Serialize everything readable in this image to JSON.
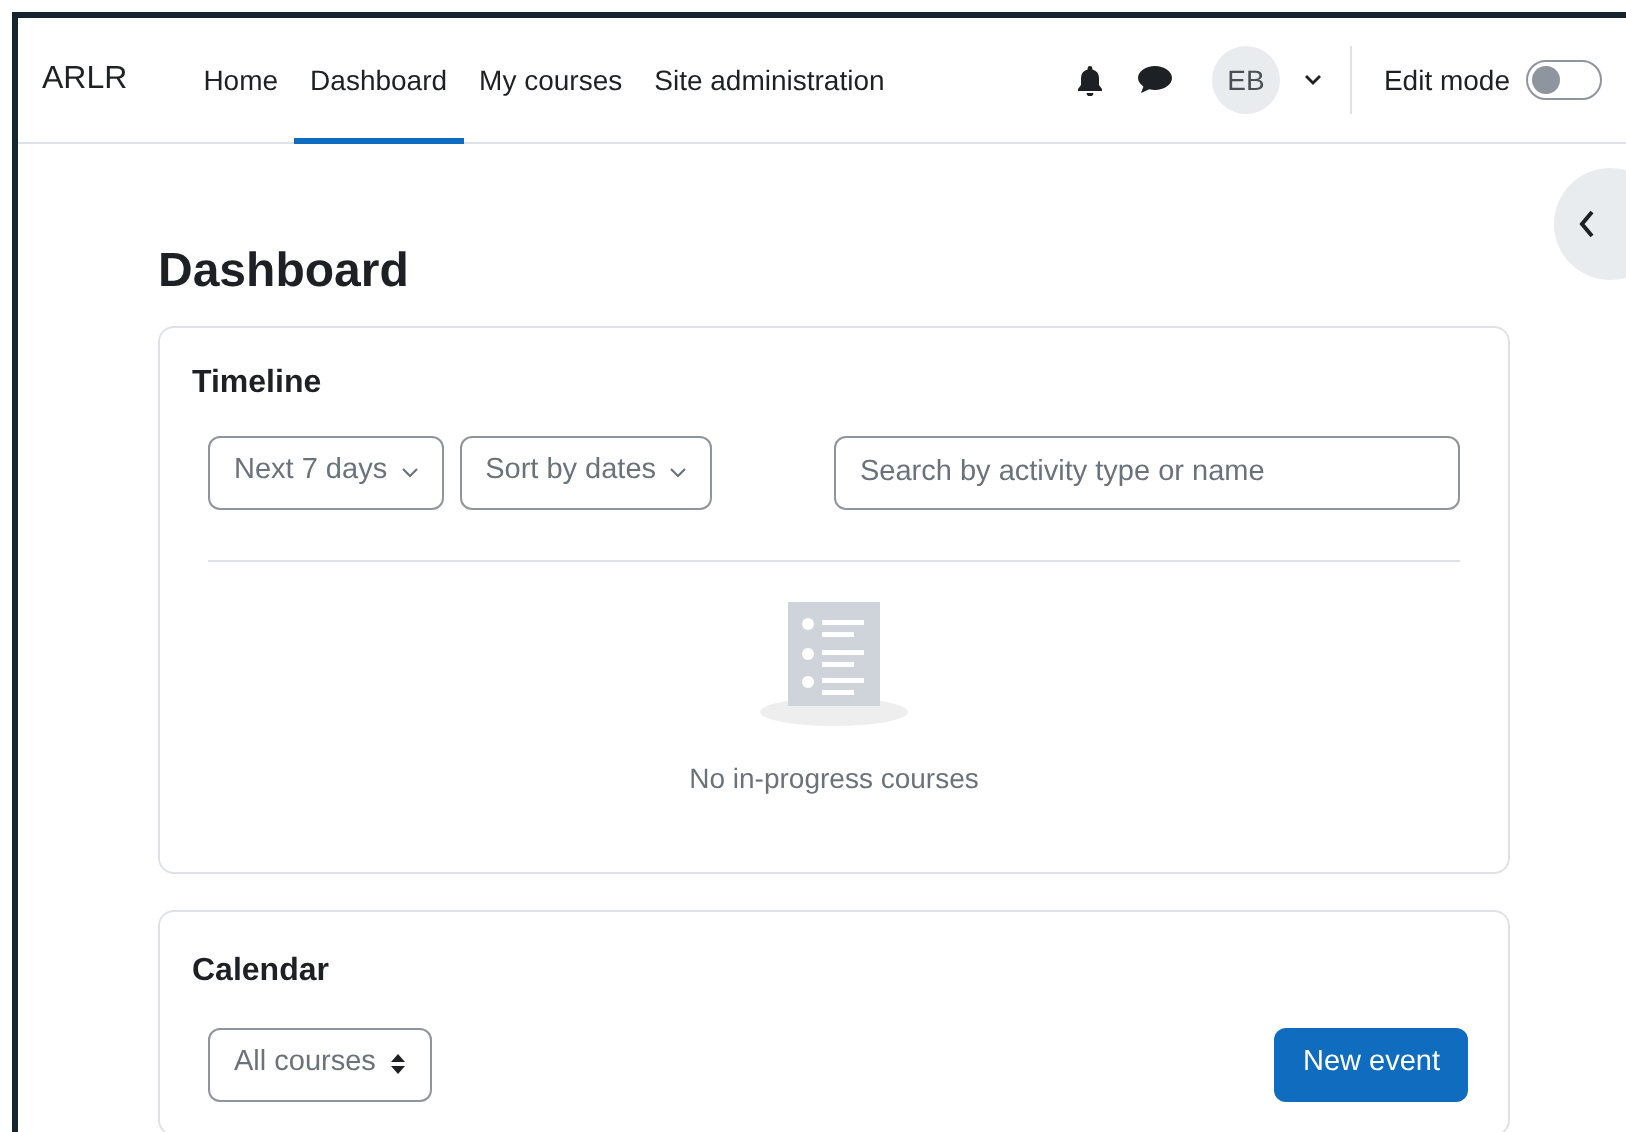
{
  "navbar": {
    "brand": "ARLR",
    "items": [
      {
        "label": "Home",
        "selected": false
      },
      {
        "label": "Dashboard",
        "selected": true
      },
      {
        "label": "My courses",
        "selected": false
      },
      {
        "label": "Site administration",
        "selected": false
      }
    ],
    "avatar": "EB",
    "edit_mode": {
      "label": "Edit mode",
      "on": false
    }
  },
  "page_title": "Dashboard",
  "timeline": {
    "title": "Timeline",
    "filters": [
      "Next 7 days",
      "Sort by dates"
    ],
    "search": {
      "placeholder": "Search by activity type or name"
    },
    "empty_message": "No in-progress courses"
  },
  "calendar": {
    "title": "Calendar",
    "course_select": "All courses",
    "new_event_button": "New event"
  }
}
